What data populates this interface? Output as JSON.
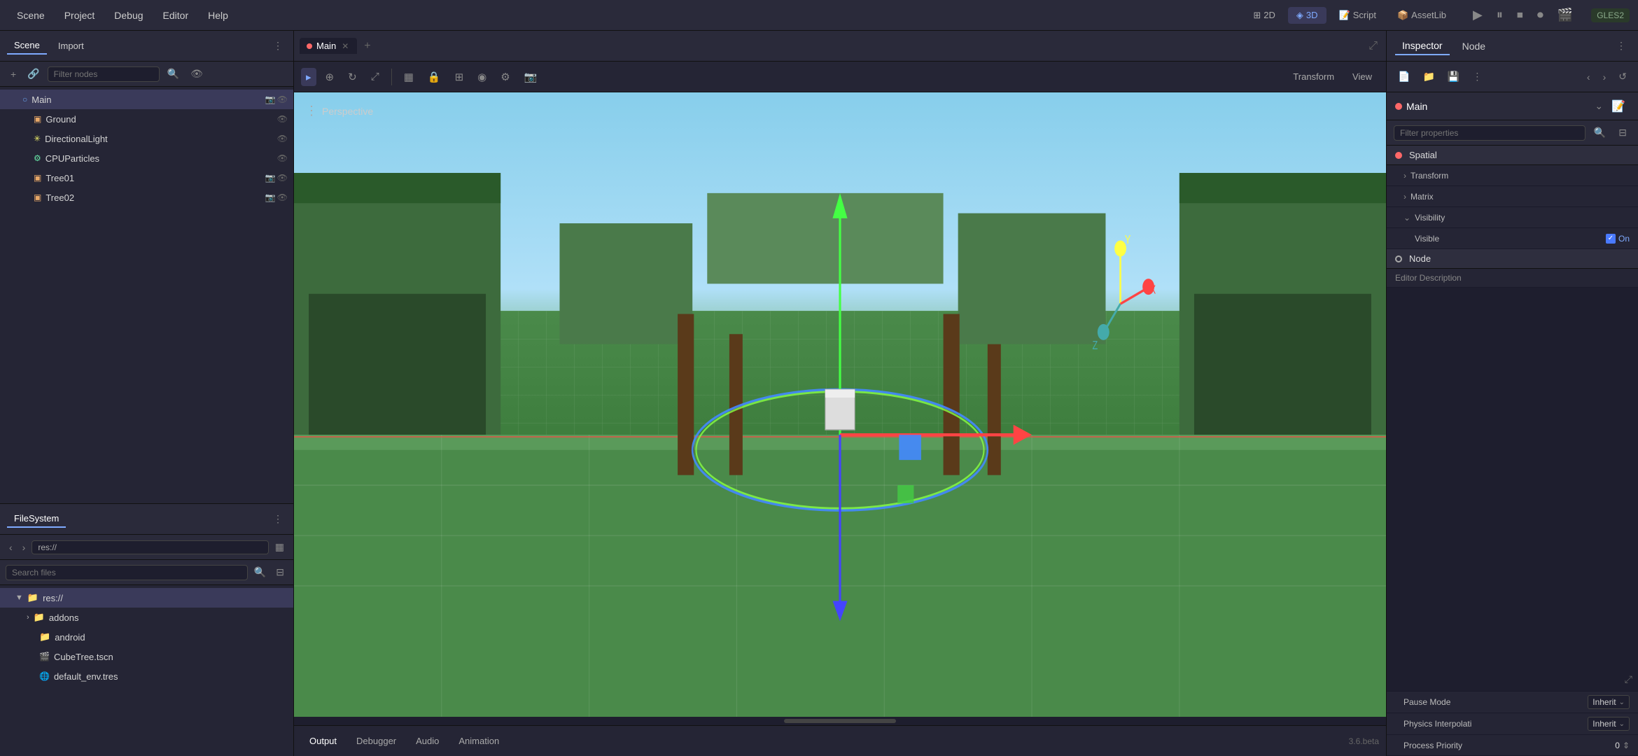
{
  "menubar": {
    "items": [
      {
        "label": "Scene",
        "id": "scene"
      },
      {
        "label": "Project",
        "id": "project"
      },
      {
        "label": "Debug",
        "id": "debug"
      },
      {
        "label": "Editor",
        "id": "editor"
      },
      {
        "label": "Help",
        "id": "help"
      }
    ],
    "mode2d": "2D",
    "mode3d": "3D",
    "script": "Script",
    "assetlib": "AssetLib",
    "gles": "GLES2"
  },
  "scene_panel": {
    "tab_scene": "Scene",
    "tab_import": "Import",
    "filter_placeholder": "Filter nodes",
    "nodes": [
      {
        "label": "Main",
        "type": "scene",
        "indent": 0,
        "selected": true
      },
      {
        "label": "Ground",
        "type": "mesh",
        "indent": 1
      },
      {
        "label": "DirectionalLight",
        "type": "light",
        "indent": 1
      },
      {
        "label": "CPUParticles",
        "type": "particles",
        "indent": 1
      },
      {
        "label": "Tree01",
        "type": "mesh",
        "indent": 1
      },
      {
        "label": "Tree02",
        "type": "mesh",
        "indent": 1
      }
    ]
  },
  "filesystem_panel": {
    "title": "FileSystem",
    "path": "res://",
    "search_placeholder": "Search files",
    "items": [
      {
        "label": "res://",
        "type": "folder",
        "indent": 0,
        "expanded": true
      },
      {
        "label": "addons",
        "type": "folder",
        "indent": 1
      },
      {
        "label": "android",
        "type": "folder",
        "indent": 1
      },
      {
        "label": "CubeTree.tscn",
        "type": "scene",
        "indent": 1
      },
      {
        "label": "default_env.tres",
        "type": "resource",
        "indent": 1
      }
    ]
  },
  "viewport": {
    "tab_main": "Main",
    "perspective_label": "Perspective",
    "version": "3.6.beta"
  },
  "viewport_toolbar": {
    "tools": [
      "▸",
      "⊕",
      "↻",
      "⤢",
      "▦",
      "🔒",
      "⊞",
      "◉",
      "⚙",
      "📷"
    ],
    "transform_label": "Transform",
    "view_label": "View"
  },
  "bottom_tabs": {
    "items": [
      {
        "label": "Output"
      },
      {
        "label": "Debugger"
      },
      {
        "label": "Audio"
      },
      {
        "label": "Animation"
      }
    ]
  },
  "inspector": {
    "tab_inspector": "Inspector",
    "tab_node": "Node",
    "node_name": "Main",
    "filter_placeholder": "Filter properties",
    "sections": {
      "spatial": {
        "title": "Spatial",
        "items": [
          {
            "label": "Transform",
            "type": "expandable"
          },
          {
            "label": "Matrix",
            "type": "expandable"
          },
          {
            "label": "Visibility",
            "type": "collapsible",
            "expanded": true
          },
          {
            "label": "Visible",
            "type": "checkbox",
            "value": "On",
            "checked": true
          }
        ]
      },
      "node": {
        "title": "Node",
        "items": [
          {
            "label": "Editor Description",
            "type": "text"
          }
        ]
      }
    },
    "pause_mode": {
      "label": "Pause Mode",
      "value": "Inherit"
    },
    "physics_interpolation": {
      "label": "Physics Interpolati",
      "value": "Inherit"
    },
    "process_priority": {
      "label": "Process Priority",
      "value": "0"
    }
  },
  "icons": {
    "play": "▶",
    "pause": "⏸",
    "stop": "⏹",
    "record": "⏺",
    "film": "🎬",
    "plus": "+",
    "link": "🔗",
    "search": "🔍",
    "settings": "⚙",
    "more_vert": "⋮",
    "eye": "👁",
    "camera": "📷",
    "chevron_right": "›",
    "chevron_left": "‹",
    "chevron_down": "⌄",
    "expand": "⤢",
    "folder": "📁",
    "file": "📄",
    "scene_file": "🎬",
    "filter": "⊟",
    "back": "←",
    "forward": "→",
    "grid": "▦"
  }
}
